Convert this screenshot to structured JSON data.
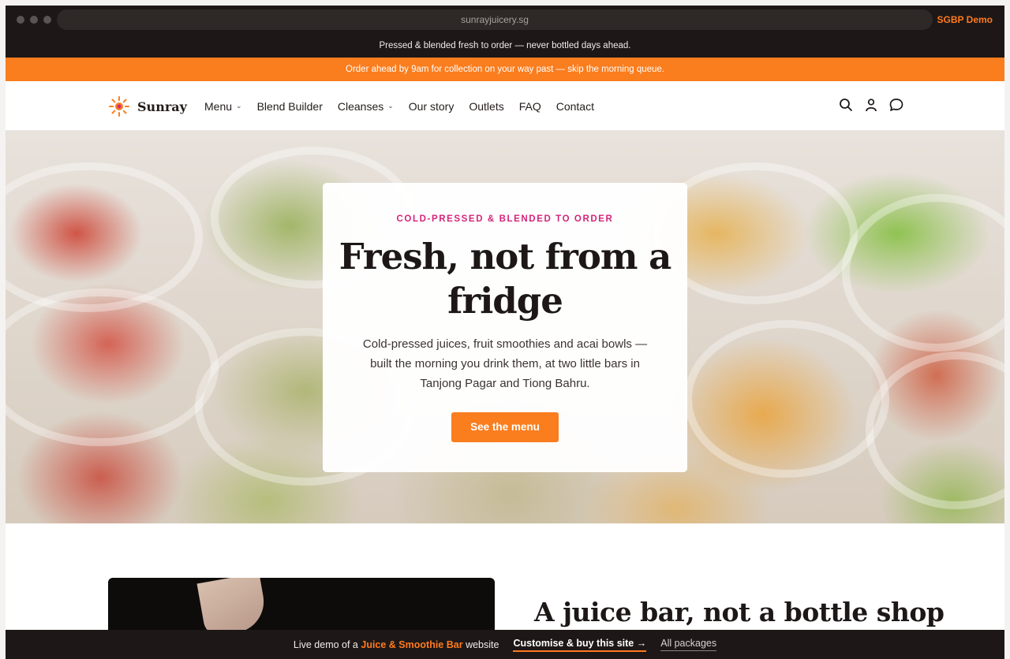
{
  "browser": {
    "url": "sunrayjuicery.sg",
    "demo_tag": "SGBP Demo"
  },
  "announcement": "Pressed & blended fresh to order — never bottled days ahead.",
  "promo": "Order ahead by 9am for collection on your way past — skip the morning queue.",
  "brand": {
    "name": "Sunray",
    "accent_color": "#fa7d1e",
    "eyebrow_color": "#d6247a"
  },
  "nav": {
    "items": [
      {
        "label": "Menu",
        "dropdown": true
      },
      {
        "label": "Blend Builder",
        "dropdown": false
      },
      {
        "label": "Cleanses",
        "dropdown": true
      },
      {
        "label": "Our story",
        "dropdown": false
      },
      {
        "label": "Outlets",
        "dropdown": false
      },
      {
        "label": "FAQ",
        "dropdown": false
      },
      {
        "label": "Contact",
        "dropdown": false
      }
    ],
    "icons": [
      "search-icon",
      "account-icon",
      "chat-icon"
    ]
  },
  "hero": {
    "eyebrow": "COLD-PRESSED & BLENDED TO ORDER",
    "title": "Fresh, not from a fridge",
    "description": "Cold-pressed juices, fruit smoothies and acai bowls — built the morning you drink them, at two little bars in Tanjong Pagar and Tiong Bahru.",
    "cta": "See the menu"
  },
  "about": {
    "title": "A juice bar, not a bottle shop"
  },
  "demobar": {
    "prefix": "Live demo of a",
    "type": "Juice & Smoothie Bar",
    "suffix": "website",
    "customise": "Customise & buy this site →",
    "packages": "All packages"
  }
}
